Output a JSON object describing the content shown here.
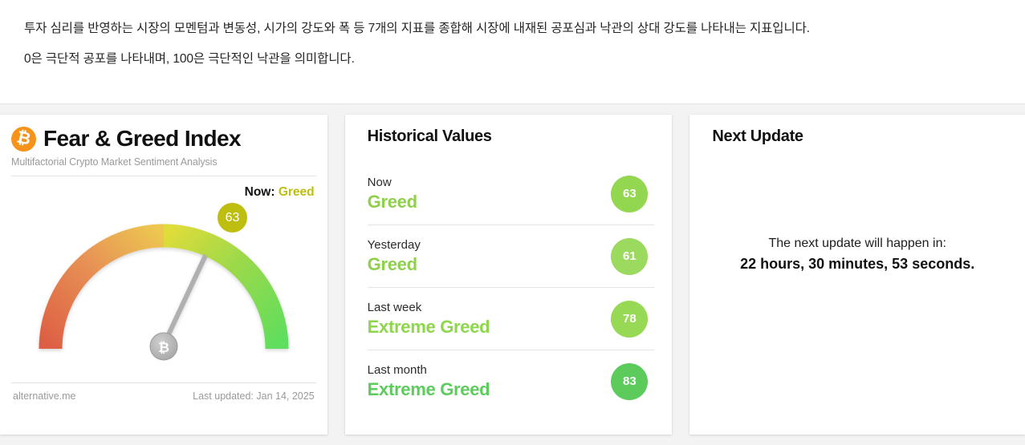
{
  "banner": {
    "line1": "투자 심리를 반영하는 시장의 모멘텀과 변동성, 시가의 강도와 폭 등 7개의 지표를 종합해 시장에 내재된 공포심과 낙관의 상대 강도를 나타내는 지표입니다.",
    "line2": "0은 극단적 공포를 나타내며, 100은 극단적인 낙관을 의미합니다."
  },
  "gauge_panel": {
    "logo_icon": "bitcoin-icon",
    "logo_glyph": "₿",
    "title": "Fear & Greed Index",
    "subtitle": "Multifactorial Crypto Market Sentiment Analysis",
    "now_label": "Now:",
    "now_value": "Greed",
    "now_color": "#bdbe10",
    "source": "alternative.me",
    "last_updated": "Last updated: Jan 14, 2025"
  },
  "chart_data": {
    "type": "gauge",
    "title": "Fear & Greed Index",
    "value": 63,
    "value_label": "63",
    "classification": "Greed",
    "min": 0,
    "max": 100,
    "needle_glyph": "₿",
    "badge_color": "#bdbe10",
    "arc_start_color": "#e06146",
    "arc_mid_color": "#ecd14a",
    "arc_end_color": "#5ede5e",
    "arc_stops": [
      {
        "offset": 0,
        "color": "#dd5f44"
      },
      {
        "offset": 0.22,
        "color": "#e79255"
      },
      {
        "offset": 0.45,
        "color": "#edc750"
      },
      {
        "offset": 0.62,
        "color": "#dbdc3c"
      },
      {
        "offset": 0.8,
        "color": "#9bd94a"
      },
      {
        "offset": 1,
        "color": "#5ede5e"
      }
    ],
    "xlabel": "",
    "ylabel": "",
    "grid": false
  },
  "historical": {
    "title": "Historical Values",
    "rows": [
      {
        "period": "Now",
        "classification": "Greed",
        "value": "63",
        "badge_color": "#93d750",
        "text_color": "#8fd04c"
      },
      {
        "period": "Yesterday",
        "classification": "Greed",
        "value": "61",
        "badge_color": "#9cd95f",
        "text_color": "#8fd04c"
      },
      {
        "period": "Last week",
        "classification": "Extreme Greed",
        "value": "78",
        "badge_color": "#97d954",
        "text_color": "#8ed64c"
      },
      {
        "period": "Last month",
        "classification": "Extreme Greed",
        "value": "83",
        "badge_color": "#5ccb5c",
        "text_color": "#5ecb5e"
      }
    ]
  },
  "next_update": {
    "title": "Next Update",
    "lead": "The next update will happen in:",
    "time": "22 hours, 30 minutes, 53 seconds."
  }
}
